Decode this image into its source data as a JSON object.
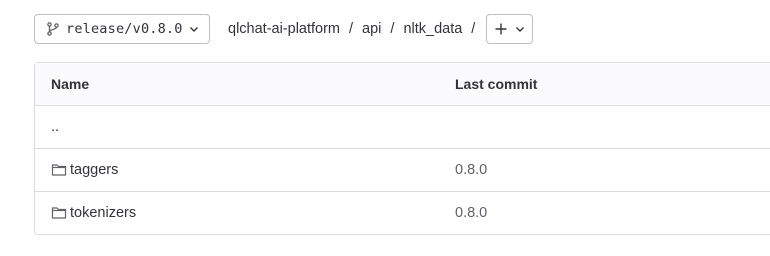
{
  "branch": {
    "name": "release/v0.8.0",
    "icon": "branch-icon"
  },
  "breadcrumb": {
    "items": [
      "qlchat-ai-platform",
      "api",
      "nltk_data"
    ],
    "separator": "/"
  },
  "add_button": {
    "icon": "plus-icon"
  },
  "table": {
    "headers": {
      "name": "Name",
      "last_commit": "Last commit"
    },
    "parent_row": {
      "name": ".."
    },
    "rows": [
      {
        "name": "taggers",
        "type": "folder",
        "last_commit": "0.8.0"
      },
      {
        "name": "tokenizers",
        "type": "folder",
        "last_commit": "0.8.0"
      }
    ]
  }
}
